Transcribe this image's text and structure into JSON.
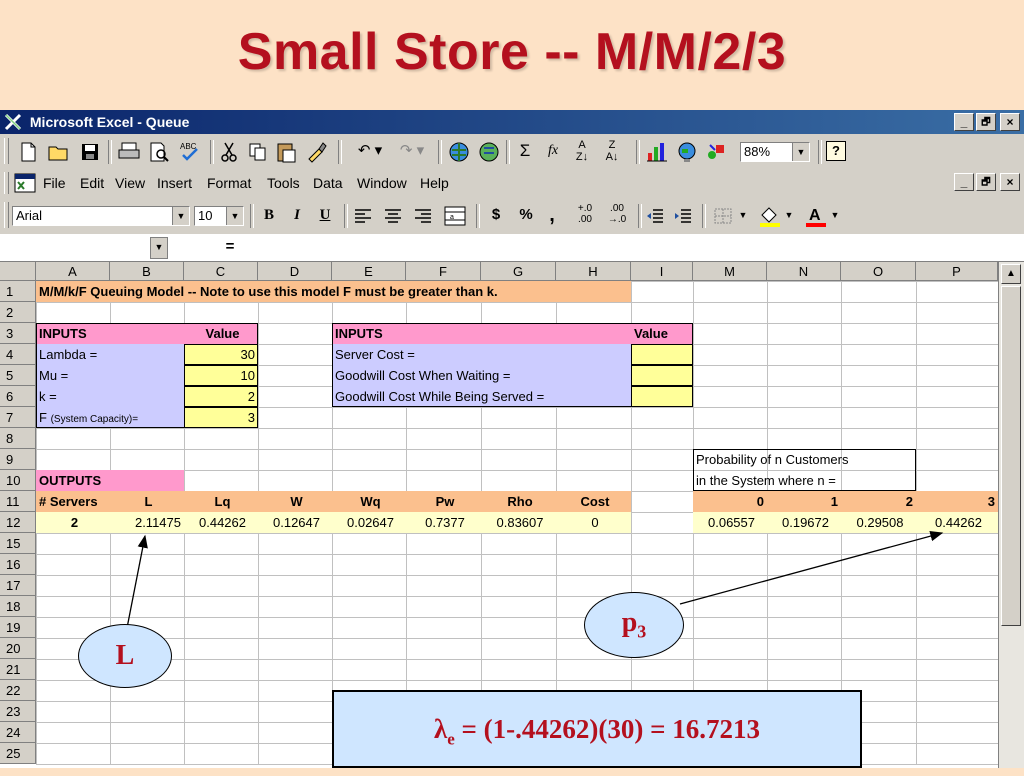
{
  "slide": {
    "title": "Small Store -- M/M/2/3",
    "bubble_L": "L",
    "bubble_p_base": "p",
    "bubble_p_sub": "3",
    "formula_lambda": "λ",
    "formula_sub": "e",
    "formula_rest": " = (1-.44262)(30) = 16.7213"
  },
  "window": {
    "title": "Microsoft Excel - Queue",
    "minimize": "_",
    "restore": "🗗",
    "close": "×"
  },
  "toolbar": {
    "zoom": "88%",
    "font_name": "Arial",
    "font_size": "10",
    "bold": "B",
    "italic": "I",
    "underline": "U",
    "currency": "$",
    "percent": "%",
    "comma": ",",
    "sum": "Σ",
    "fx": "fx"
  },
  "menu": [
    "File",
    "Edit",
    "View",
    "Insert",
    "Format",
    "Tools",
    "Data",
    "Window",
    "Help"
  ],
  "formula_bar": {
    "name_box": "",
    "equals": "="
  },
  "columns": [
    "A",
    "B",
    "C",
    "D",
    "E",
    "F",
    "G",
    "H",
    "I",
    "M",
    "N",
    "O",
    "P"
  ],
  "rows": [
    "1",
    "2",
    "3",
    "4",
    "5",
    "6",
    "7",
    "8",
    "9",
    "10",
    "11",
    "12",
    "15",
    "16",
    "17",
    "18",
    "19",
    "20",
    "21",
    "22",
    "23",
    "24",
    "25"
  ],
  "sheet": {
    "r1_note": "M/M/k/F Queuing Model  -- Note to use this model F must be greater than k.",
    "inputs_left_header": "INPUTS",
    "value_left_header": "Value",
    "inputs_left": [
      {
        "label": "Lambda =",
        "value": "30"
      },
      {
        "label": "Mu =",
        "value": "10"
      },
      {
        "label": "k =",
        "value": "2"
      },
      {
        "label_main": "F ",
        "label_small": "(System Capacity)=",
        "value": "3"
      }
    ],
    "inputs_right_header": "INPUTS",
    "value_right_header": "Value",
    "inputs_right": [
      "Server Cost =",
      "Goodwill Cost When Waiting =",
      "Goodwill Cost While Being Served ="
    ],
    "prob_title_1": "Probability of n Customers",
    "prob_title_2": "in the System where n =",
    "outputs_header": "OUTPUTS",
    "output_headers": [
      "# Servers",
      "L",
      "Lq",
      "W",
      "Wq",
      "Pw",
      "Rho",
      "Cost"
    ],
    "output_values": [
      "2",
      "2.11475",
      "0.44262",
      "0.12647",
      "0.02647",
      "0.7377",
      "0.83607",
      "0"
    ],
    "prob_headers": [
      "0",
      "1",
      "2",
      "3"
    ],
    "prob_values": [
      "0.06557",
      "0.19672",
      "0.29508",
      "0.44262"
    ]
  },
  "colors": {
    "orange_header": "#fbc08e",
    "pink_header": "#ff99cc",
    "lavender": "#ccccff",
    "yellow": "#ffff99",
    "pale_yellow": "#ffffcc",
    "title_red": "#b4101e",
    "bubble_blue": "#cfe6ff"
  }
}
